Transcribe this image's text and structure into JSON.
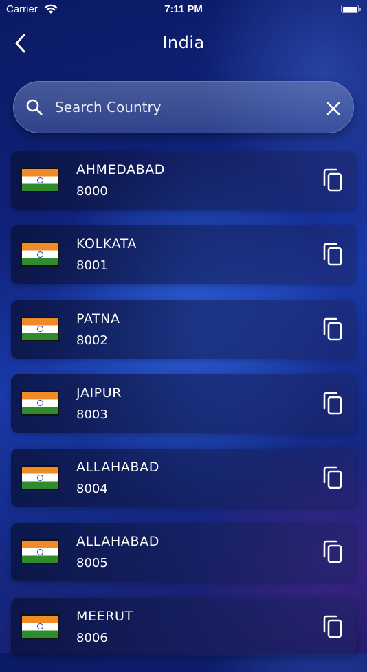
{
  "status_bar": {
    "carrier": "Carrier",
    "time": "7:11 PM"
  },
  "header": {
    "title": "India"
  },
  "search": {
    "placeholder": "Search Country",
    "value": ""
  },
  "cities": [
    {
      "name": "AHMEDABAD",
      "code": "8000"
    },
    {
      "name": "KOLKATA",
      "code": "8001"
    },
    {
      "name": "PATNA",
      "code": "8002"
    },
    {
      "name": "JAIPUR",
      "code": "8003"
    },
    {
      "name": "ALLAHABAD",
      "code": "8004"
    },
    {
      "name": "ALLAHABAD",
      "code": "8005"
    },
    {
      "name": "MEERUT",
      "code": "8006"
    }
  ],
  "icons": {
    "back": "chevron-left-icon",
    "search": "search-icon",
    "clear": "close-icon",
    "copy": "copy-icon",
    "flag": "india-flag-icon"
  },
  "colors": {
    "flag_saffron": "#f08c28",
    "flag_white": "#ffffff",
    "flag_green": "#2e8b2e",
    "text": "#ffffff"
  }
}
